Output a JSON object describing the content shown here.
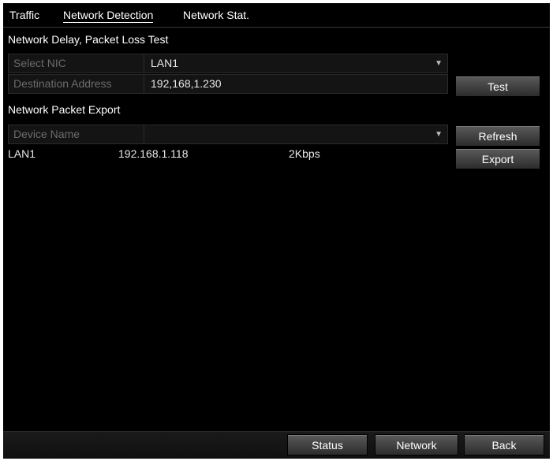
{
  "tabs": [
    {
      "label": "Traffic"
    },
    {
      "label": "Network Detection"
    },
    {
      "label": "Network Stat."
    }
  ],
  "delay_test": {
    "title": "Network Delay, Packet Loss Test",
    "nic_label": "Select NIC",
    "nic_value": "LAN1",
    "address_label": "Destination Address",
    "address_value": "192,168,1.230",
    "test_button": "Test"
  },
  "packet_export": {
    "title": "Network Packet Export",
    "device_label": "Device Name",
    "device_value": "",
    "refresh_button": "Refresh",
    "export_button": "Export",
    "rows": [
      {
        "name": "LAN1",
        "ip": "192.168.1.118",
        "rate": "2Kbps"
      }
    ]
  },
  "footer": {
    "status_button": "Status",
    "network_button": "Network",
    "back_button": "Back"
  },
  "icons": {
    "dropdown": "chevron-down-icon"
  }
}
